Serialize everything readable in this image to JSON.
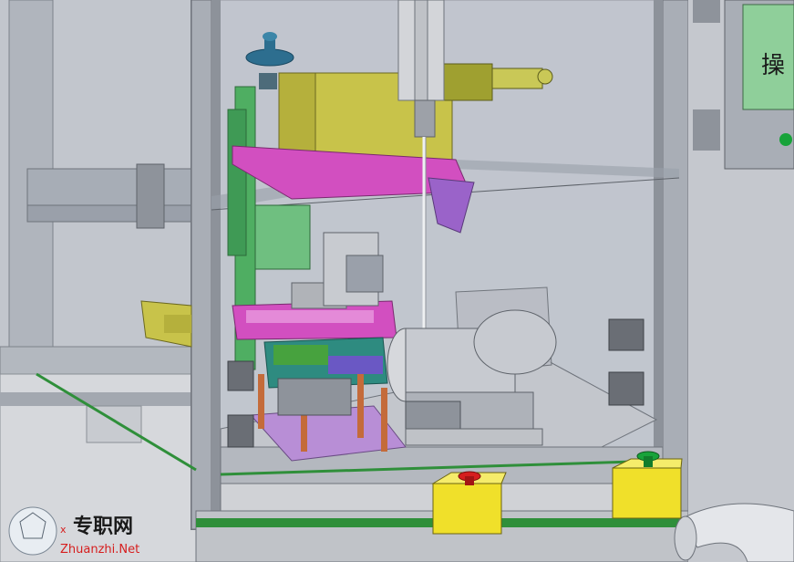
{
  "scene": {
    "description_label": "",
    "panel_text": "操",
    "watermark": {
      "cn": "专职网",
      "en": "Zhuanzhi.Net",
      "mark": "x"
    }
  },
  "colors": {
    "background": "#c9cdd3",
    "frame": "#a9aeb6",
    "frame_dark": "#6e737b",
    "glass": "#b8bcc6",
    "base_plate": "#d9d9d9",
    "green_strip": "#2f8f3a",
    "magenta": "#d24fc0",
    "yellow_green": "#c8c34a",
    "purple_plate": "#b88ed6",
    "copper": "#c46b3a",
    "teal": "#2e8b80",
    "yellow_box": "#f0e02a",
    "red_button": "#d61e1e",
    "green_button": "#18a33a",
    "screen": "#8fcf9a"
  }
}
